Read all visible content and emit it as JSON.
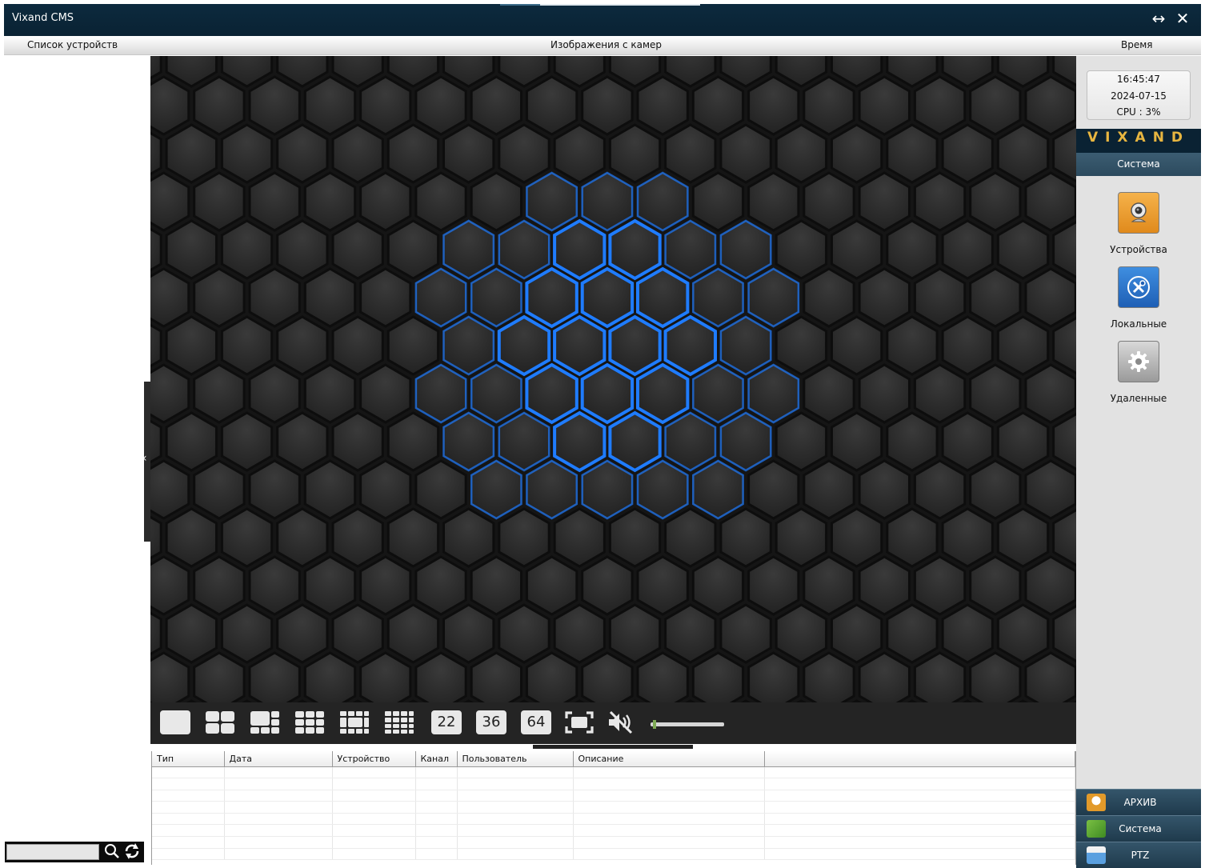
{
  "app": {
    "title": "Vixand CMS"
  },
  "window_controls": {
    "resize": "↔",
    "close": "✕"
  },
  "header": {
    "left": "Список устройств",
    "center": "Изображения с камер",
    "right": "Время"
  },
  "search": {
    "value": "",
    "placeholder": ""
  },
  "toolbar": {
    "layout_22": "22",
    "layout_36": "36",
    "layout_64": "64",
    "volume_level": 0.03
  },
  "log_table": {
    "columns": [
      "Тип",
      "Дата",
      "Устройство",
      "Канал",
      "Пользователь",
      "Описание",
      ""
    ],
    "rows": []
  },
  "clock": {
    "time": "16:45:47",
    "date": "2024-07-15",
    "cpu": "CPU : 3%"
  },
  "brand": "VIXAND",
  "system_section": {
    "title": "Система",
    "items": [
      {
        "label": "Устройства",
        "icon": "webcam-icon"
      },
      {
        "label": "Локальные",
        "icon": "tools-icon"
      },
      {
        "label": "Удаленные",
        "icon": "gear-icon"
      }
    ]
  },
  "nav": {
    "archive": "АРХИВ",
    "system": "Система",
    "ptz": "PTZ"
  },
  "colors": {
    "titlebar": "#0a2233",
    "brand_text": "#e8b640",
    "hex_glow": "#1f7cff"
  }
}
